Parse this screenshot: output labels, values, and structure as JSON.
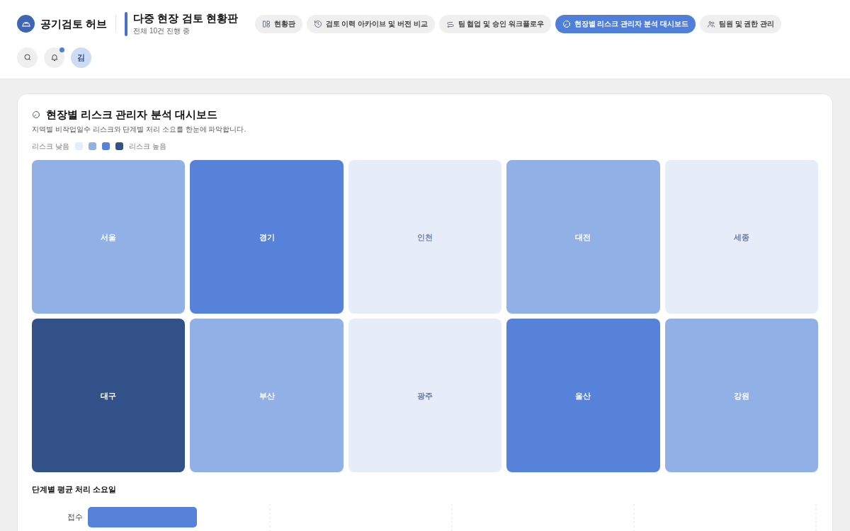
{
  "brand": {
    "name": "공기검토 허브"
  },
  "page": {
    "title": "다중 현장 검토 현황판",
    "subtitle": "전체 10건 진행 중"
  },
  "tabs": [
    {
      "label": "현황판",
      "selected": false
    },
    {
      "label": "검토 이력 아카이브 및 버전 비교",
      "selected": false
    },
    {
      "label": "팀 협업 및 승인 워크플로우",
      "selected": false
    },
    {
      "label": "현장별 리스크 관리자 분석 대시보드",
      "selected": true
    },
    {
      "label": "팀원 및 권한 관리",
      "selected": false
    }
  ],
  "toolbar": {
    "notifications_unread": true,
    "avatar": "김"
  },
  "dashboard": {
    "title": "현장별 리스크 관리자 분석 대시보드",
    "description": "지역별 비작업일수 리스크와 단계별 처리 소요를 한눈에 파악합니다.",
    "legend": {
      "low_label": "리스크 낮음",
      "high_label": "리스크 높음"
    },
    "tiles": [
      {
        "label": "서울",
        "kind": "mid"
      },
      {
        "label": "경기",
        "kind": "high"
      },
      {
        "label": "인천",
        "kind": "low"
      },
      {
        "label": "대전",
        "kind": "mid"
      },
      {
        "label": "세종",
        "kind": "low"
      },
      {
        "label": "대구",
        "kind": "critical"
      },
      {
        "label": "부산",
        "kind": "mid"
      },
      {
        "label": "광주",
        "kind": "low"
      },
      {
        "label": "울산",
        "kind": "high"
      },
      {
        "label": "강원",
        "kind": "mid"
      }
    ],
    "stage_section": {
      "title": "단계별 평균 처리 소요일",
      "rows": [
        {
          "label": "접수"
        }
      ]
    }
  }
}
